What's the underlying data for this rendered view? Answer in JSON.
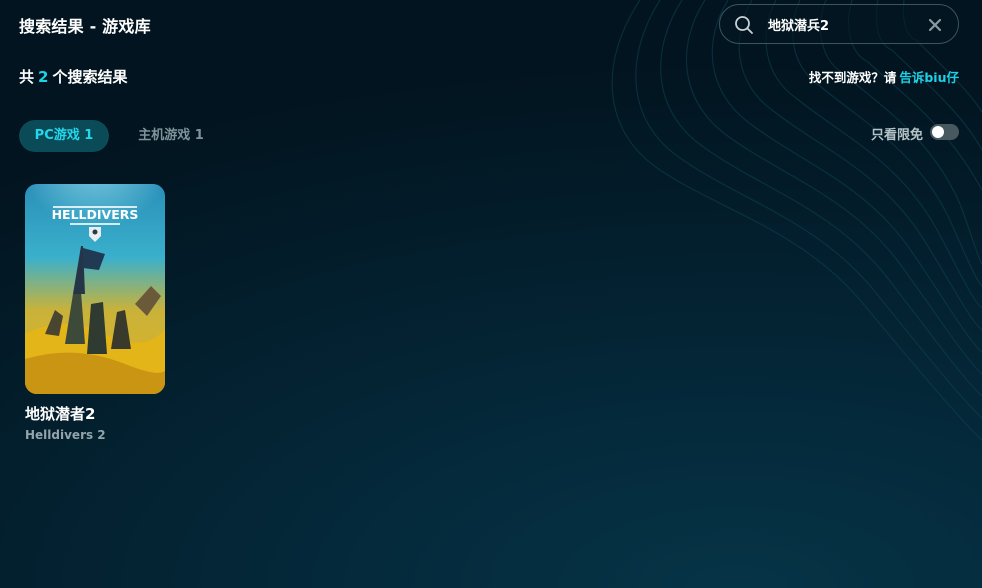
{
  "header": {
    "title": "搜索结果 - 游戏库"
  },
  "search": {
    "value": "地狱潜兵2",
    "placeholder": ""
  },
  "results": {
    "prefix": "共",
    "count": "2",
    "suffix": "个搜索结果"
  },
  "report": {
    "text": "找不到游戏？请",
    "link": "告诉biu仔"
  },
  "tabs": [
    {
      "label": "PC游戏 1",
      "active": true
    },
    {
      "label": "主机游戏 1",
      "active": false
    }
  ],
  "filter": {
    "label": "只看限免",
    "enabled": false
  },
  "games": [
    {
      "name": "地狱潜者2",
      "english_name": "Helldivers 2",
      "cover_logo_text": "HELLDIVERS"
    }
  ],
  "colors": {
    "accent": "#1bd3e8",
    "background": "#031d2b",
    "tab_active_bg": "#0b4a57",
    "muted_text": "#7f939b"
  }
}
